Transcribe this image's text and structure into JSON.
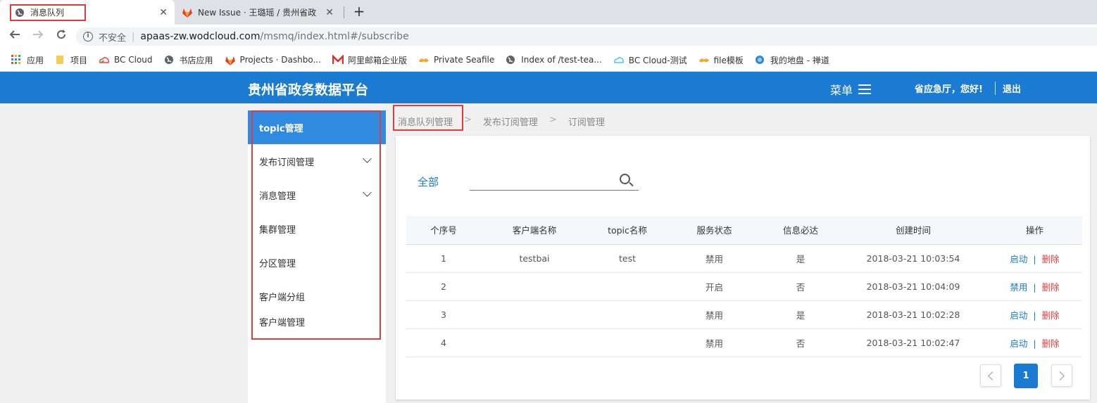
{
  "browser": {
    "tabs": [
      {
        "title": "消息队列",
        "close": "✕",
        "active": true
      },
      {
        "title": "New Issue · 王璐瑶 / 贵州省政务",
        "close": "✕",
        "active": false
      }
    ],
    "new_tab": "+",
    "security_label": "不安全",
    "url_host": "apaas-zw.wodcloud.com",
    "url_path": "/msmq/index.html#/subscribe",
    "bookmarks": [
      {
        "label": "应用",
        "icon": "apps-grid-icon"
      },
      {
        "label": "项目",
        "icon": "folder-icon"
      },
      {
        "label": "BC Cloud",
        "icon": "cloud-logo-icon"
      },
      {
        "label": "书店应用",
        "icon": "globe-icon"
      },
      {
        "label": "Projects · Dashbo...",
        "icon": "gitlab-icon"
      },
      {
        "label": "阿里邮箱企业版",
        "icon": "mail-icon"
      },
      {
        "label": "Private Seafile",
        "icon": "seafile-icon"
      },
      {
        "label": "Index of /test-tea...",
        "icon": "globe-icon"
      },
      {
        "label": "BC Cloud-测试",
        "icon": "cloud-icon"
      },
      {
        "label": "file模板",
        "icon": "seafile-icon"
      },
      {
        "label": "我的地盘 - 禅道",
        "icon": "zentao-icon"
      }
    ]
  },
  "header": {
    "brand": "贵州省政务数据平台",
    "menu_label": "菜单",
    "greeting": "省应急厅，您好!",
    "logout": "退出",
    "color": "#1b7bd3"
  },
  "sidebar": {
    "items": [
      {
        "label": "topic管理",
        "active": true,
        "expandable": false
      },
      {
        "label": "发布订阅管理",
        "active": false,
        "expandable": true
      },
      {
        "label": "消息管理",
        "active": false,
        "expandable": true
      },
      {
        "label": "集群管理",
        "active": false,
        "expandable": false
      },
      {
        "label": "分区管理",
        "active": false,
        "expandable": false
      },
      {
        "label": "客户端分组",
        "active": false,
        "expandable": false
      },
      {
        "label": "客户端管理",
        "active": false,
        "expandable": false
      }
    ]
  },
  "breadcrumb": {
    "items": [
      "消息队列管理",
      "发布订阅管理",
      "订阅管理"
    ],
    "separator": ">"
  },
  "filter": {
    "all_label": "全部",
    "search_value": ""
  },
  "table": {
    "columns": [
      "个序号",
      "客户端名称",
      "topic名称",
      "服务状态",
      "信息必达",
      "创建时间",
      "操作"
    ],
    "rows": [
      {
        "index": "1",
        "client": "testbai",
        "topic": "test",
        "status": "禁用",
        "guaranteed": "是",
        "created": "2018-03-21 10:03:54",
        "action1": "启动",
        "action2": "删除"
      },
      {
        "index": "2",
        "client": "",
        "topic": "",
        "status": "开启",
        "guaranteed": "否",
        "created": "2018-03-21 10:04:09",
        "action1": "禁用",
        "action2": "删除"
      },
      {
        "index": "3",
        "client": "",
        "topic": "",
        "status": "禁用",
        "guaranteed": "是",
        "created": "2018-03-21 10:02:28",
        "action1": "启动",
        "action2": "删除"
      },
      {
        "index": "4",
        "client": "",
        "topic": "",
        "status": "禁用",
        "guaranteed": "否",
        "created": "2018-03-21 10:02:47",
        "action1": "启动",
        "action2": "删除"
      }
    ],
    "action_separator": "|"
  },
  "pagination": {
    "current_page": "1"
  }
}
